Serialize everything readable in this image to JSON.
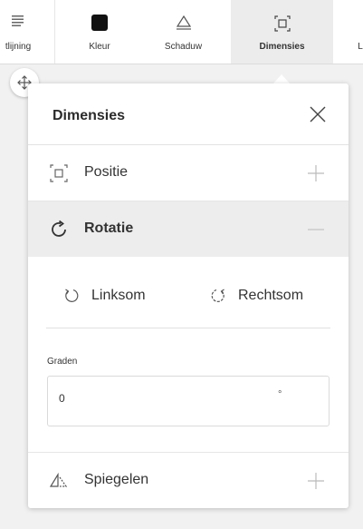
{
  "toolbar": {
    "tools": [
      {
        "label": "tlijning",
        "icon": "align-icon",
        "active": false
      },
      {
        "label": "Kleur",
        "icon": "color-swatch-icon",
        "active": false
      },
      {
        "label": "Schaduw",
        "icon": "shadow-icon",
        "active": false
      },
      {
        "label": "Dimensies",
        "icon": "dimensions-icon",
        "active": true
      },
      {
        "label": "L",
        "icon": "",
        "active": false
      }
    ]
  },
  "panel": {
    "title": "Dimensies",
    "positie": {
      "label": "Positie"
    },
    "rotatie": {
      "label": "Rotatie",
      "left_label": "Linksom",
      "right_label": "Rechtsom"
    },
    "graden": {
      "label": "Graden",
      "value": "0",
      "unit": "°"
    },
    "spiegelen": {
      "label": "Spiegelen"
    }
  },
  "colors": {
    "active_tab_bg": "#ececec",
    "panel_bg": "#ffffff",
    "icon_gray": "#777777"
  }
}
